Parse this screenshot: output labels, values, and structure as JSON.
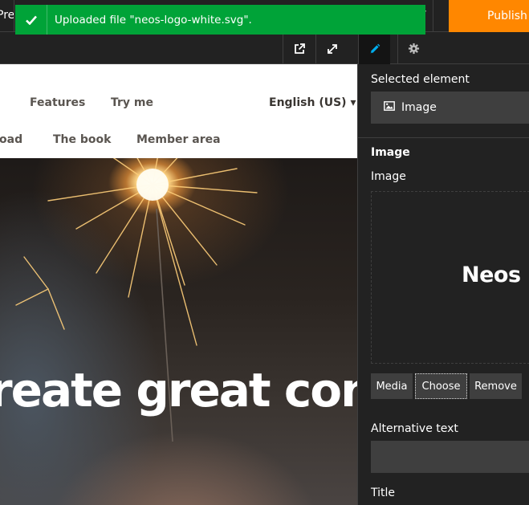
{
  "topbar": {
    "preview_tab_label": "Preview",
    "publish_label": "Publish"
  },
  "notification": {
    "message": "Uploaded file \"neos-logo-white.svg\"."
  },
  "toolbar": {
    "icons": [
      "external-link-icon",
      "fullscreen-icon",
      "pencil-icon",
      "gear-icon"
    ]
  },
  "website": {
    "nav_row1": [
      "Features",
      "Try me"
    ],
    "language": "English (US) ▾",
    "nav_row2": [
      "oad",
      "The book",
      "Member area"
    ],
    "headline": "reate great con"
  },
  "inspector": {
    "selected_element_label": "Selected element",
    "selected_element_value": "Image",
    "section_title": "Image",
    "image_field_label": "Image",
    "image_preview_text": "Neos",
    "buttons": {
      "media": "Media",
      "choose": "Choose",
      "remove": "Remove"
    },
    "alt_text_label": "Alternative text",
    "alt_text_value": "",
    "title_label": "Title"
  },
  "colors": {
    "publish": "#ff8700",
    "notification_success": "#00a338",
    "active_tool_icon": "#00adee",
    "panel_bg": "#222222",
    "control_bg": "#3f3f3f"
  }
}
